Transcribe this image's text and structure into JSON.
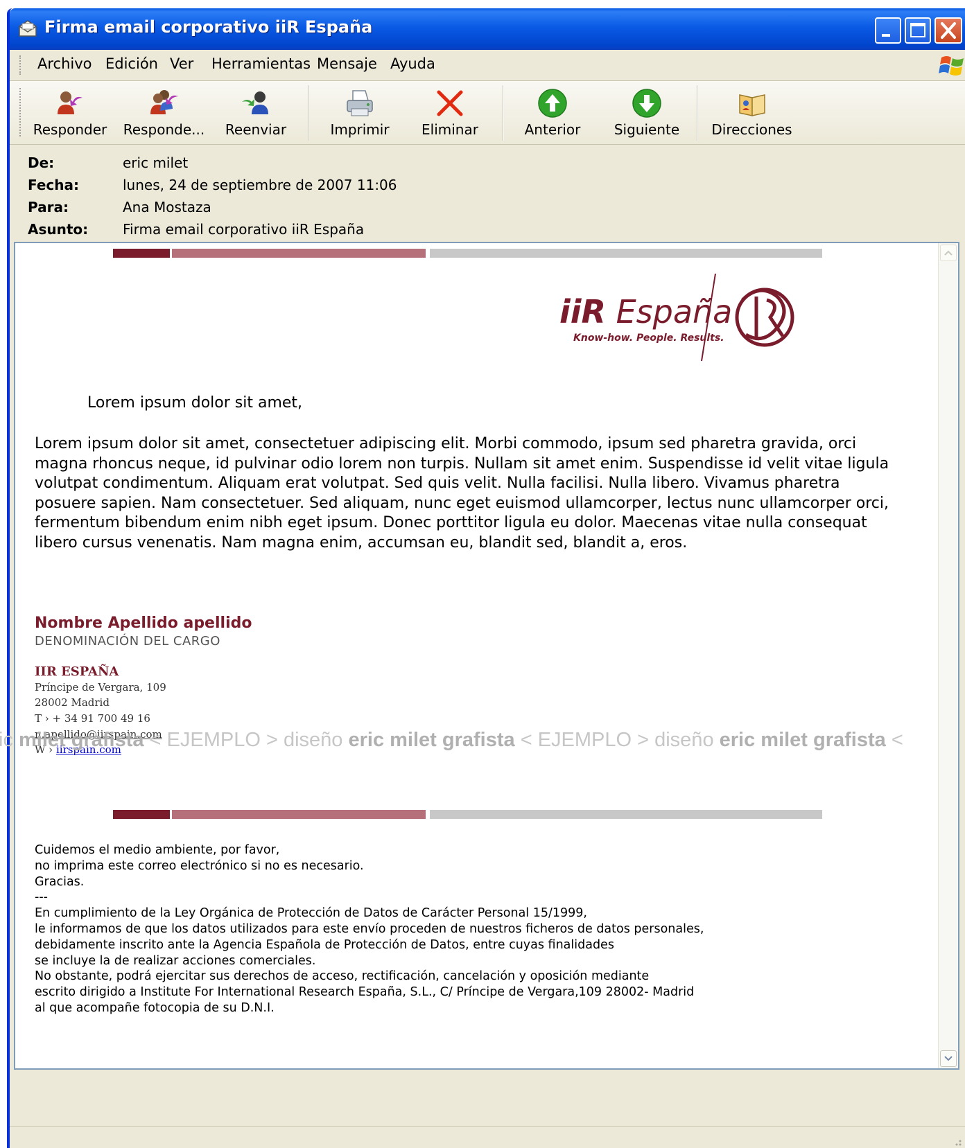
{
  "window": {
    "title": "Firma email corporativo iiR España"
  },
  "menu": {
    "items": [
      "Archivo",
      "Edición",
      "Ver",
      "Herramientas",
      "Mensaje",
      "Ayuda"
    ]
  },
  "toolbar": {
    "buttons": [
      {
        "label": "Responder",
        "icon": "reply-icon"
      },
      {
        "label": "Responde...",
        "icon": "reply-all-icon"
      },
      {
        "label": "Reenviar",
        "icon": "forward-icon"
      },
      {
        "label": "Imprimir",
        "icon": "printer-icon"
      },
      {
        "label": "Eliminar",
        "icon": "delete-x-icon"
      },
      {
        "label": "Anterior",
        "icon": "arrow-up-icon"
      },
      {
        "label": "Siguiente",
        "icon": "arrow-down-icon"
      },
      {
        "label": "Direcciones",
        "icon": "address-book-icon"
      }
    ]
  },
  "headers": {
    "from_label": "De:",
    "from": "eric milet",
    "date_label": "Fecha:",
    "date": "lunes, 24 de septiembre de 2007 11:06",
    "to_label": "Para:",
    "to": "Ana Mostaza",
    "subject_label": "Asunto:",
    "subject": "Firma email corporativo iiR España"
  },
  "message": {
    "logo_iir": "iiR",
    "logo_espana": "España",
    "logo_tagline": "Know-how. People. Results.",
    "greeting": "Lorem ipsum dolor sit amet,",
    "body": "Lorem ipsum dolor sit amet, consectetuer adipiscing elit. Morbi commodo, ipsum sed pharetra gravida, orci magna rhoncus neque, id pulvinar odio lorem non turpis. Nullam sit amet enim. Suspendisse id velit vitae ligula volutpat condimentum. Aliquam erat volutpat. Sed quis velit. Nulla facilisi. Nulla libero. Vivamus pharetra posuere sapien. Nam consectetuer. Sed aliquam, nunc eget euismod ullamcorper, lectus nunc ullamcorper orci, fermentum bibendum enim nibh eget ipsum. Donec porttitor ligula eu dolor. Maecenas vitae nulla consequat libero cursus venenatis. Nam magna enim, accumsan eu, blandit sed, blandit a, eros.",
    "signature": {
      "name": "Nombre Apellido apellido",
      "title": "DENOMINACIÓN DEL CARGO",
      "company": "IIR ESPAÑA",
      "address1": "Príncipe de Vergara, 109",
      "address2": "28002 Madrid",
      "phone": "T › + 34 91 700 49 16",
      "email": "n.apellido@iirspain.com",
      "web_prefix": "W ›",
      "web": "iirspain.com"
    },
    "footer_lines": [
      "Cuidemos el medio ambiente, por favor,",
      "no imprima este correo electrónico si no es necesario.",
      "Gracias.",
      "---",
      "En cumplimiento de la Ley Orgánica de Protección de Datos de Carácter Personal 15/1999,",
      "le informamos de que los datos utilizados para este envío proceden de nuestros ficheros de datos personales,",
      "debidamente inscrito ante la Agencia Española de Protección de Datos, entre cuyas finalidades",
      "se incluye la de realizar acciones comerciales.",
      "No obstante, podrá ejercitar sus derechos de acceso, rectificación, cancelación y oposición mediante",
      "escrito dirigido a Institute For International Research España, S.L., C/ Príncipe de Vergara,109 28002- Madrid",
      "al que acompañe fotocopia de su D.N.I."
    ]
  },
  "watermark": {
    "segments": [
      {
        "text": "ic ",
        "bold": false
      },
      {
        "text": "milet grafista",
        "bold": true
      },
      {
        "text": " < EJEMPLO > diseño ",
        "bold": false
      },
      {
        "text": "eric milet grafista",
        "bold": true
      },
      {
        "text": " < EJEMPLO > diseño ",
        "bold": false
      },
      {
        "text": "eric milet grafista",
        "bold": true
      },
      {
        "text": " <",
        "bold": false
      }
    ]
  },
  "colors": {
    "brand_dark": "#7a1c2c",
    "brand_light": "#b5707a",
    "bar_grey": "#c8c8c8"
  }
}
